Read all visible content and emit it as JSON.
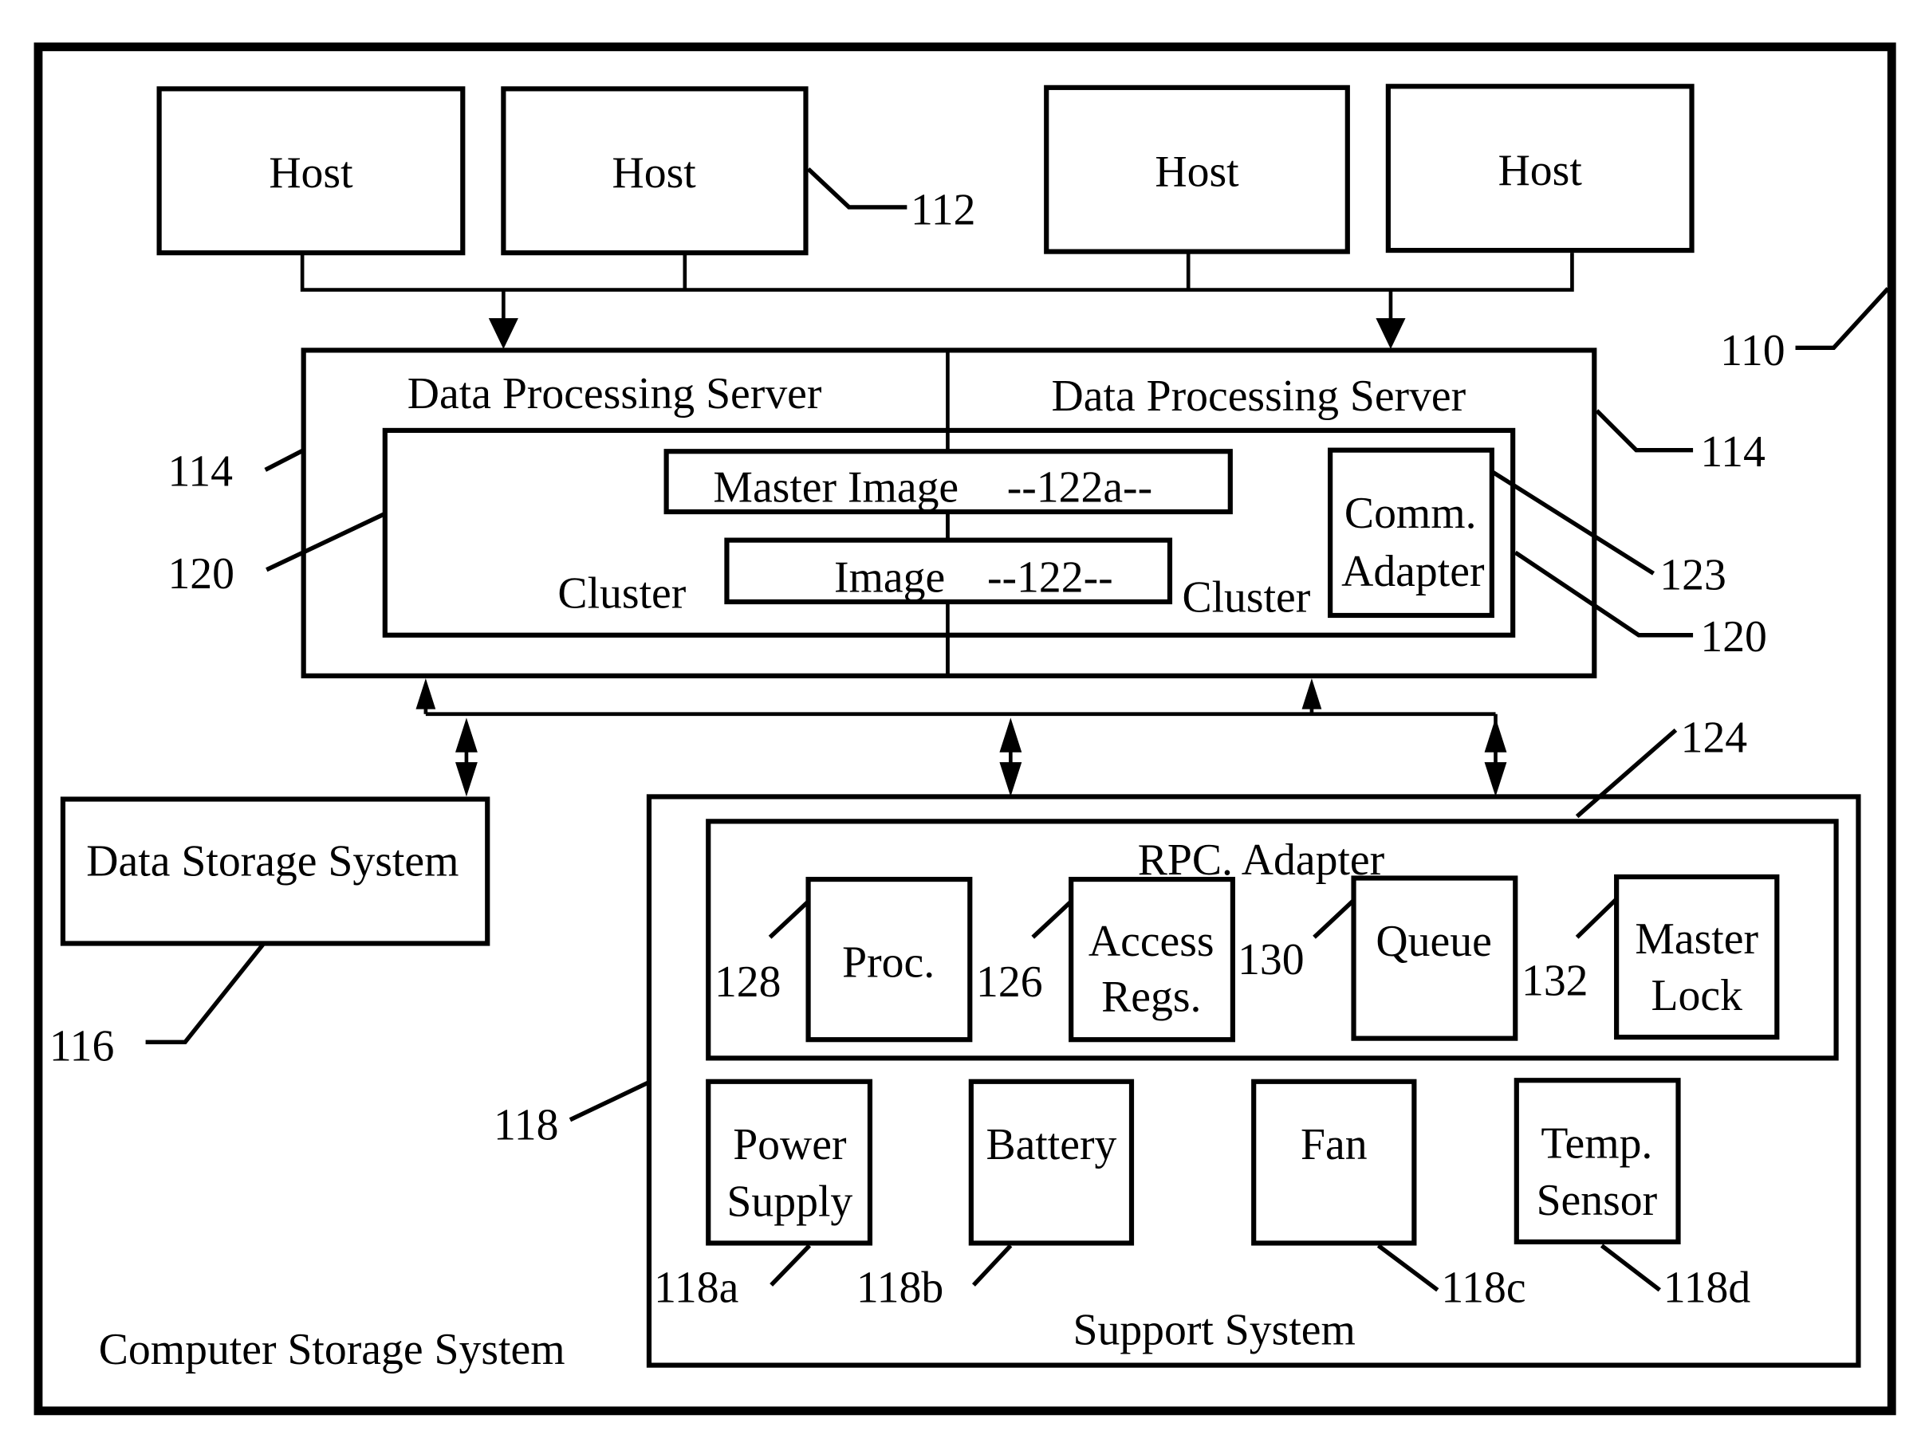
{
  "diagram": {
    "system_label": "Computer Storage System",
    "system_ref": "110",
    "hosts": [
      {
        "label": "Host"
      },
      {
        "label": "Host"
      },
      {
        "label": "Host"
      },
      {
        "label": "Host"
      }
    ],
    "hosts_ref": "112",
    "servers": [
      {
        "label": "Data Processing Server",
        "ref": "114"
      },
      {
        "label": "Data Processing Server",
        "ref": "114"
      }
    ],
    "clusters": [
      {
        "label": "Cluster",
        "ref": "120"
      },
      {
        "label": "Cluster",
        "ref": "120"
      }
    ],
    "master_image": {
      "label": "Master Image",
      "ref": "--122a--"
    },
    "image": {
      "label": "Image",
      "ref": "--122--"
    },
    "comm_adapter": {
      "line1": "Comm.",
      "line2": "Adapter",
      "ref": "123"
    },
    "data_storage": {
      "label": "Data Storage System",
      "ref": "116"
    },
    "support_system": {
      "label": "Support System",
      "ref": "118"
    },
    "rpc_adapter": {
      "label": "RPC. Adapter",
      "ref": "124",
      "components": [
        {
          "line1": "Proc.",
          "line2": "",
          "ref": "128"
        },
        {
          "line1": "Access",
          "line2": "Regs.",
          "ref": "126"
        },
        {
          "line1": "Queue",
          "line2": "",
          "ref": "130"
        },
        {
          "line1": "Master",
          "line2": "Lock",
          "ref": "132"
        }
      ]
    },
    "support_components": [
      {
        "line1": "Power",
        "line2": "Supply",
        "ref": "118a"
      },
      {
        "line1": "Battery",
        "line2": "",
        "ref": "118b"
      },
      {
        "line1": "Fan",
        "line2": "",
        "ref": "118c"
      },
      {
        "line1": "Temp.",
        "line2": "Sensor",
        "ref": "118d"
      }
    ]
  }
}
